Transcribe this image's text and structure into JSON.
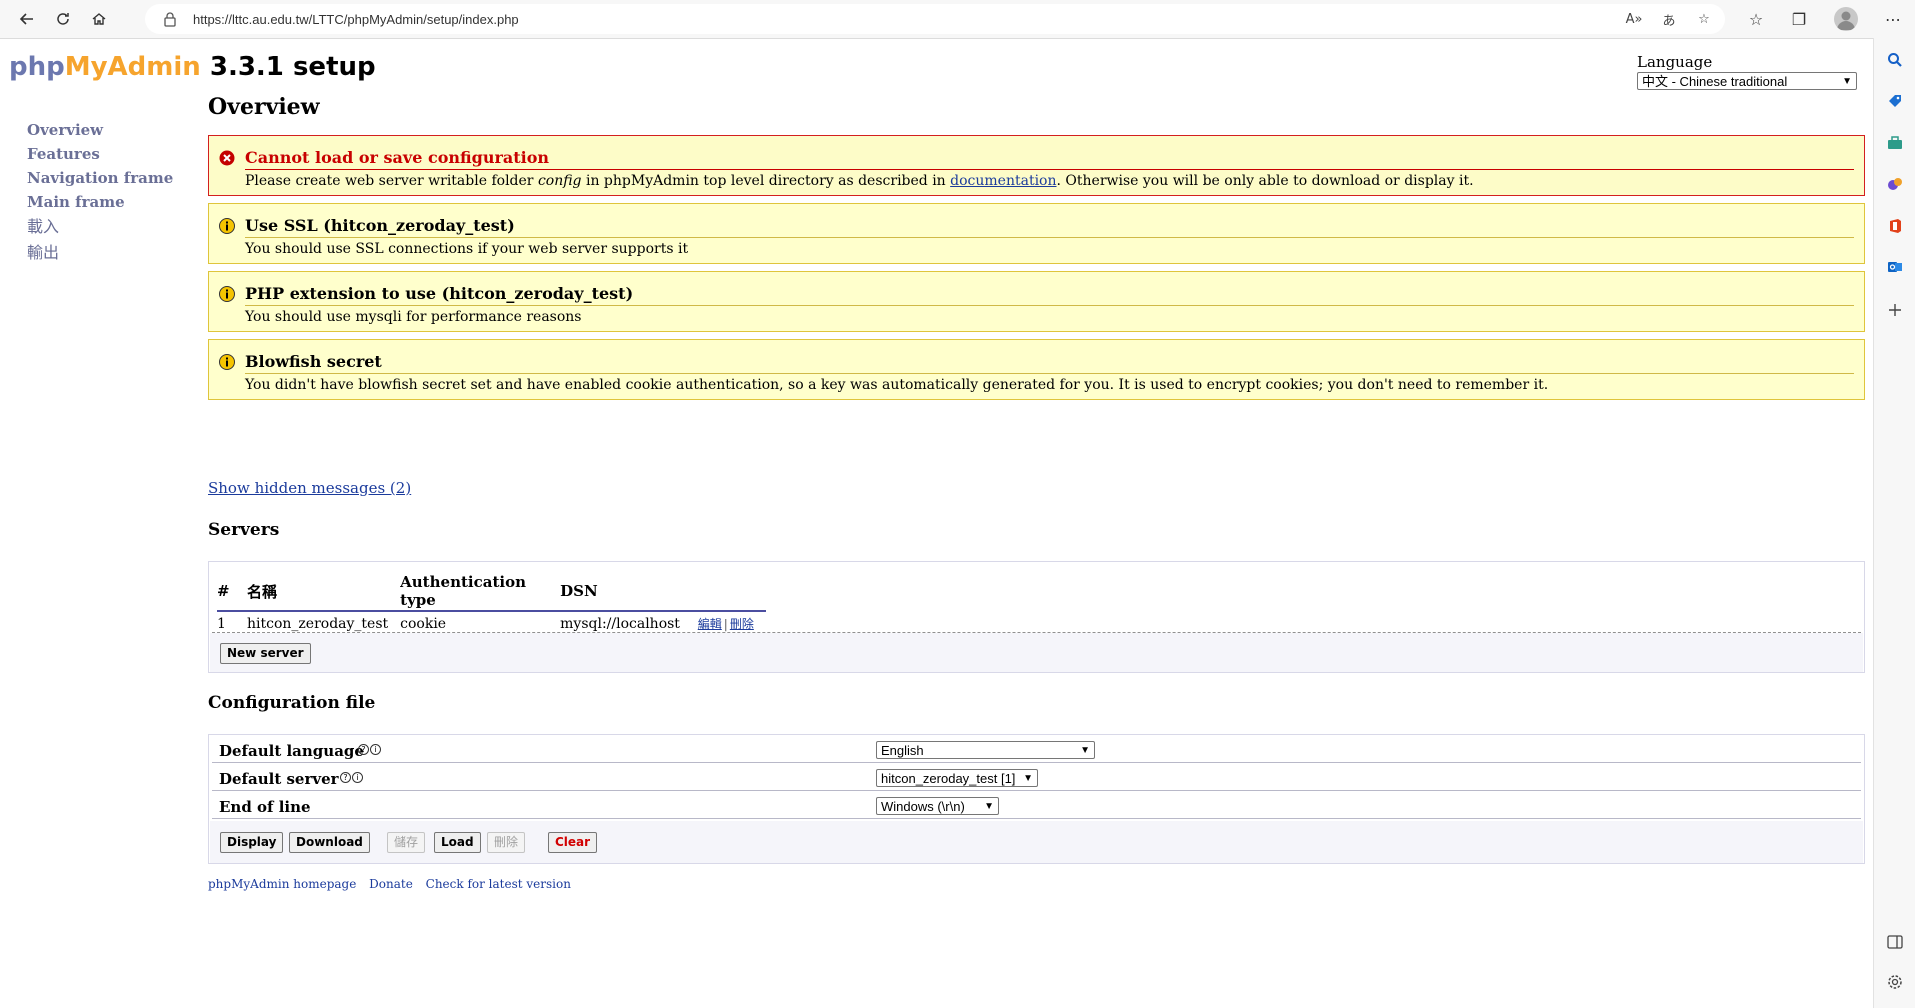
{
  "browser": {
    "url": "https://lttc.au.edu.tw/LTTC/phpMyAdmin/setup/index.php"
  },
  "logo": {
    "php": "php",
    "my": "MyAdmin",
    "version": "3.3.1 setup"
  },
  "language": {
    "label": "Language",
    "selected": "中文 - Chinese traditional"
  },
  "menu": [
    {
      "label": "Overview"
    },
    {
      "label": "Features"
    },
    {
      "label": "Navigation frame"
    },
    {
      "label": "Main frame"
    },
    {
      "label": "載入"
    },
    {
      "label": "輸出"
    }
  ],
  "overview": {
    "title": "Overview",
    "messages": [
      {
        "type": "error",
        "title": "Cannot load or save configuration",
        "body_before": "Please create web server writable folder ",
        "body_em": "config",
        "body_mid": " in phpMyAdmin top level directory as described in ",
        "body_link": "documentation",
        "body_after": ". Otherwise you will be only able to download or display it."
      },
      {
        "type": "notice",
        "title": "Use SSL (hitcon_zeroday_test)",
        "body": "You should use SSL connections if your web server supports it"
      },
      {
        "type": "notice",
        "title": "PHP extension to use (hitcon_zeroday_test)",
        "body": "You should use mysqli for performance reasons"
      },
      {
        "type": "notice",
        "title": "Blowfish secret",
        "body": "You didn't have blowfish secret set and have enabled cookie authentication, so a key was automatically generated for you. It is used to encrypt cookies; you don't need to remember it."
      }
    ],
    "hidden_messages_link": "Show hidden messages (2)"
  },
  "servers": {
    "title": "Servers",
    "columns": [
      "#",
      "名稱",
      "Authentication type",
      "DSN"
    ],
    "rows": [
      {
        "num": "1",
        "name": "hitcon_zeroday_test",
        "auth": "cookie",
        "dsn": "mysql://localhost",
        "edit": "編輯",
        "delete": "刪除"
      }
    ],
    "new_server_button": "New server"
  },
  "config": {
    "title": "Configuration file",
    "rows": [
      {
        "label": "Default language",
        "value": "English"
      },
      {
        "label": "Default server",
        "value": "hitcon_zeroday_test [1]"
      },
      {
        "label": "End of line",
        "value": "Windows (\\r\\n)"
      }
    ],
    "buttons": {
      "display": "Display",
      "download": "Download",
      "save": "儲存",
      "load": "Load",
      "delete": "刪除",
      "clear": "Clear"
    }
  },
  "footer": {
    "homepage": "phpMyAdmin homepage",
    "donate": "Donate",
    "check": "Check for latest version"
  },
  "colors": {
    "logo_php": "#6c78af",
    "logo_my": "#f6a42d",
    "notice_bg": "#ffffcc",
    "error_title": "#c80000",
    "link": "#1b3b9c"
  }
}
